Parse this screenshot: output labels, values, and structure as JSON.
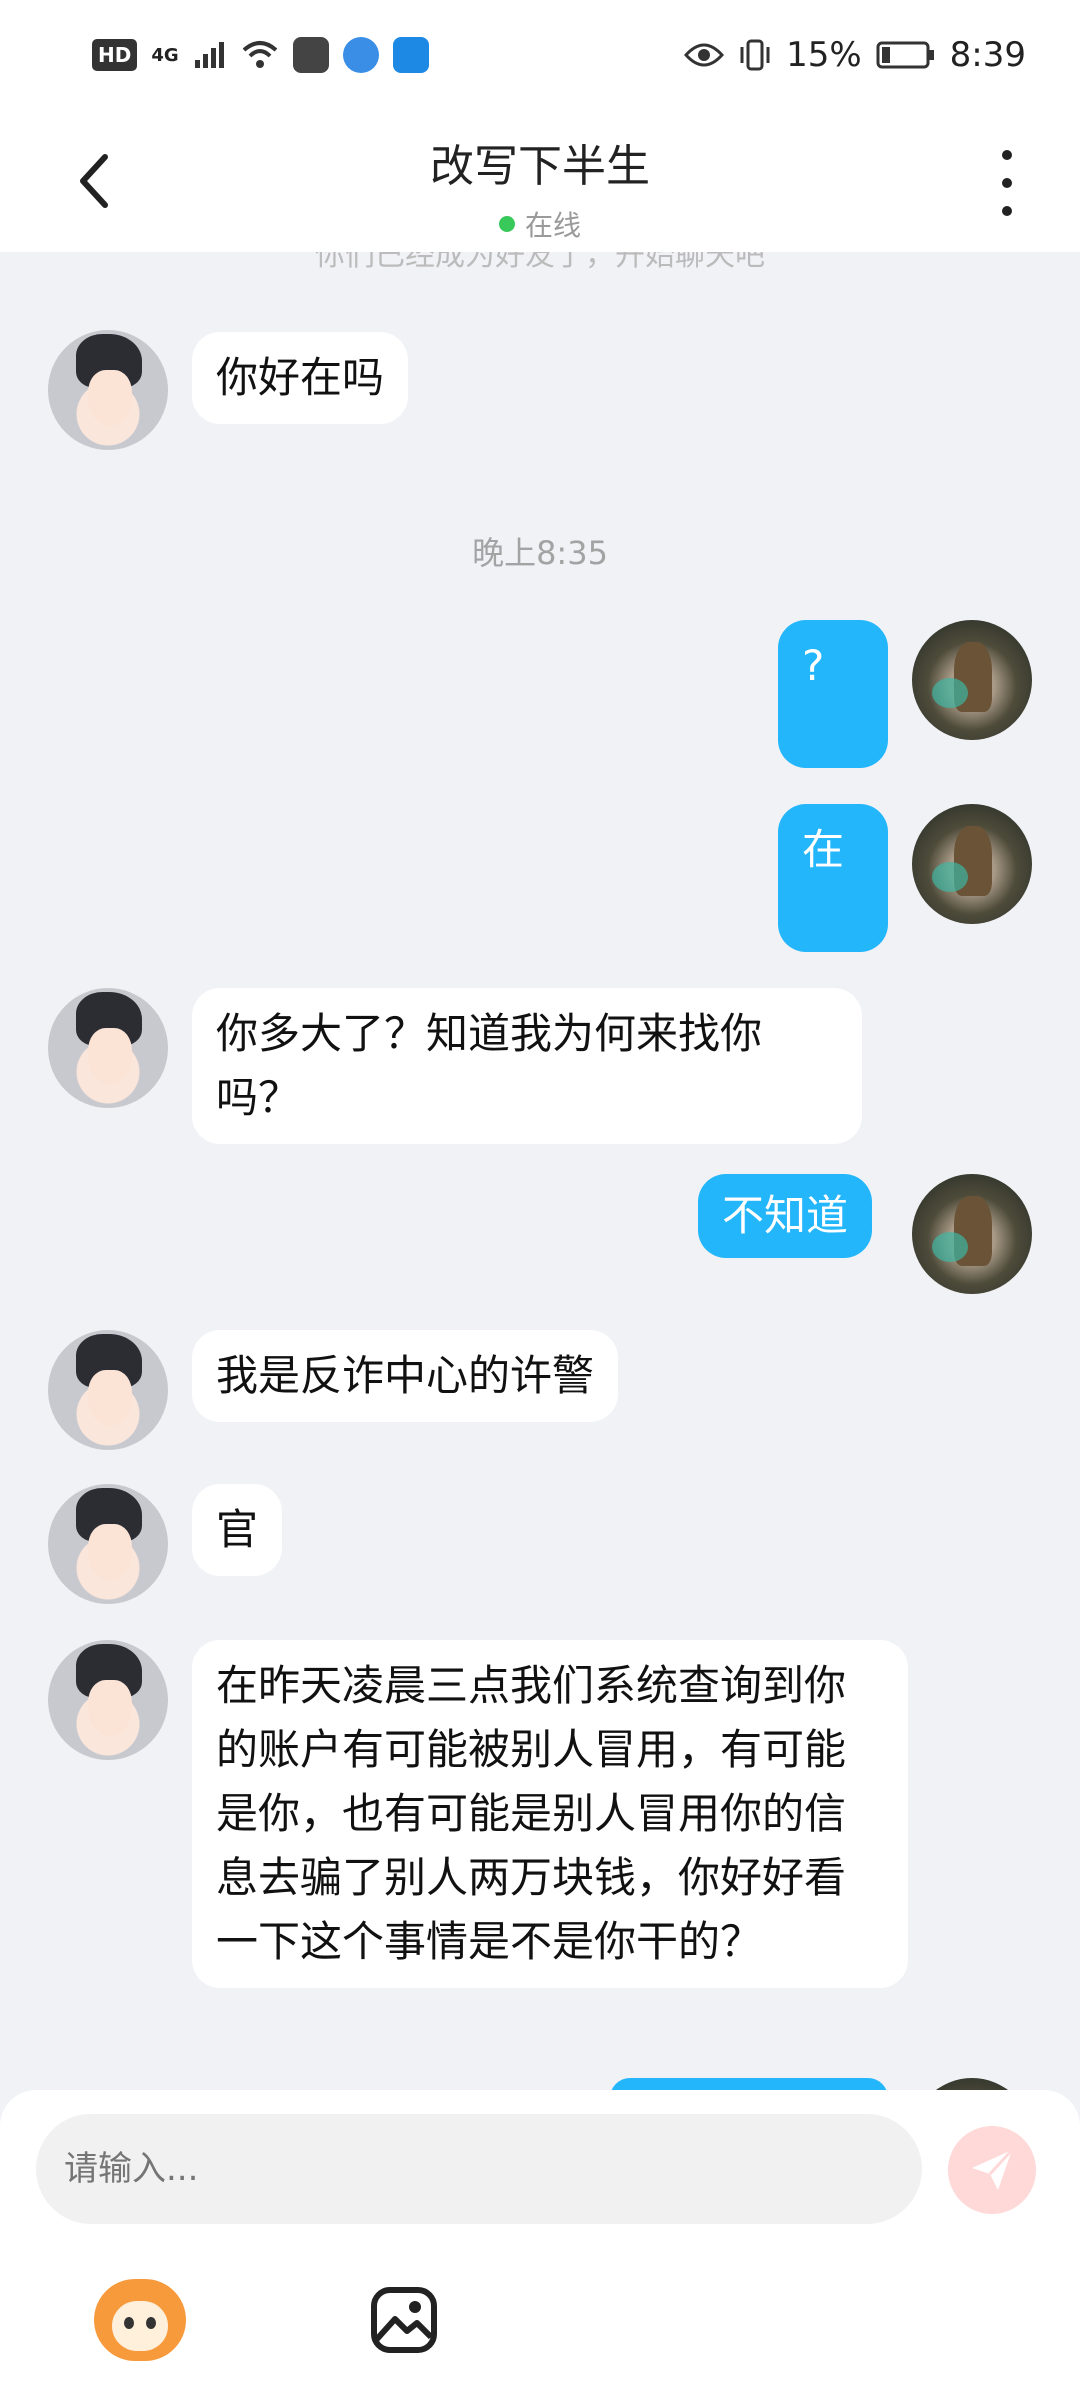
{
  "status_bar": {
    "hd": "HD",
    "network": "4G",
    "battery_percent": "15%",
    "time": "8:39"
  },
  "header": {
    "title": "改写下半生",
    "status": "在线"
  },
  "chat": {
    "system_hint": "你们已经成为好友了，开始聊天吧",
    "messages": [
      {
        "side": "left",
        "text": "你好在吗"
      },
      {
        "type": "time",
        "text": "晚上8:35"
      },
      {
        "side": "right",
        "text": "?"
      },
      {
        "side": "right",
        "text": "在"
      },
      {
        "side": "left",
        "text": "你多大了？知道我为何来找你吗？"
      },
      {
        "side": "right",
        "text": "不知道"
      },
      {
        "side": "left",
        "text": "我是反诈中心的许警"
      },
      {
        "side": "left",
        "text": "官"
      },
      {
        "side": "left",
        "text": "在昨天凌晨三点我们系统查询到你的账户有可能被别人冒用，有可能是你，也有可能是别人冒用你的信息去骗了别人两万块钱，你好好看一下这个事情是不是你干的？"
      }
    ]
  },
  "input": {
    "placeholder": "请输入..."
  },
  "icons": {
    "back": "chevron-left-icon",
    "more": "more-vertical-icon",
    "send": "send-icon",
    "emoji": "monkey-sticker-icon",
    "image": "image-icon"
  },
  "colors": {
    "accent": "#23b6fb",
    "background": "#f0f2f6",
    "online": "#39c85a"
  }
}
